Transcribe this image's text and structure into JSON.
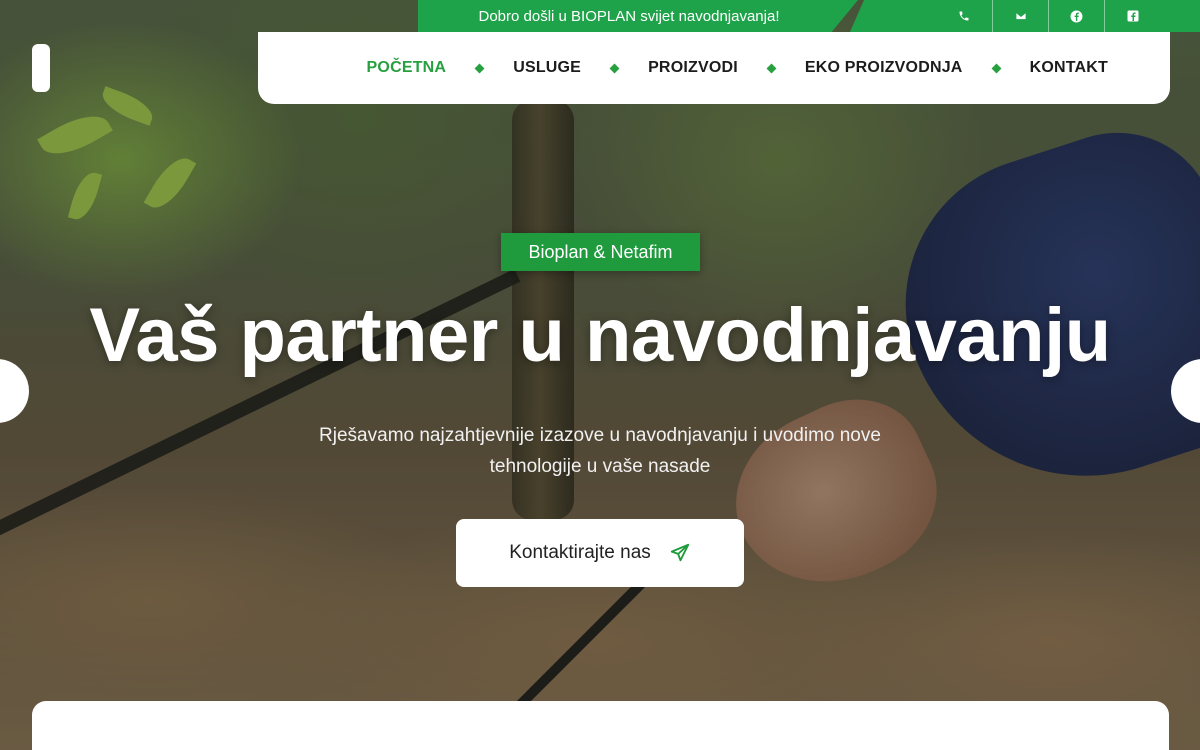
{
  "topbar": {
    "welcome_text": "Dobro došli u BIOPLAN svijet navodnjavanja!",
    "socials": [
      {
        "icon": "phone-icon"
      },
      {
        "icon": "mail-icon"
      },
      {
        "icon": "facebook-icon"
      },
      {
        "icon": "facebook-square-icon"
      }
    ]
  },
  "nav": {
    "items": [
      {
        "label": "POČETNA",
        "active": true
      },
      {
        "label": "USLUGE"
      },
      {
        "label": "PROIZVODI"
      },
      {
        "label": "EKO PROIZVODNJA"
      },
      {
        "label": "KONTAKT"
      }
    ]
  },
  "hero": {
    "badge": "Bioplan & Netafim",
    "headline": "Vaš partner u navodnjavanju",
    "subtitle_line1": "Rješavamo najzahtjevnije izazove u navodnjavanju i uvodimo nove",
    "subtitle_line2": "tehnologije u vaše nasade",
    "cta_label": "Kontaktirajte nas",
    "cta_icon": "send-icon"
  },
  "colors": {
    "brand_green": "#1fa34a",
    "nav_active": "#27a13f"
  }
}
